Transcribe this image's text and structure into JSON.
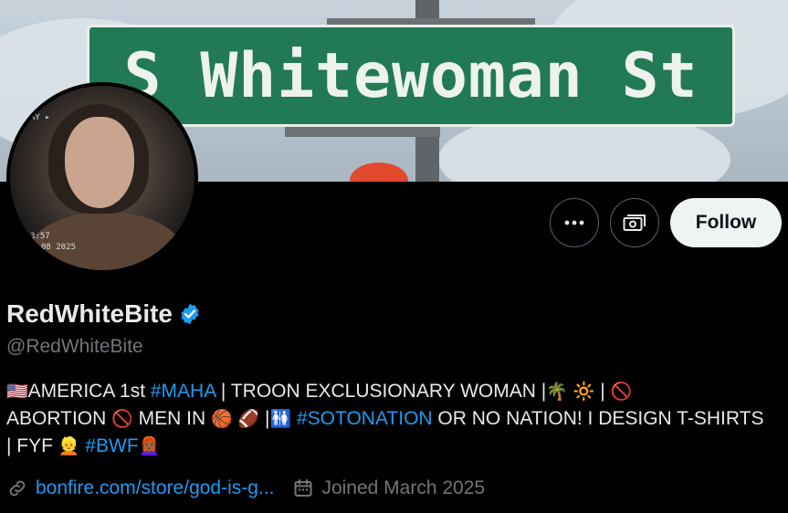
{
  "banner": {
    "sign_text": "S Whitewoman St"
  },
  "avatar": {
    "timestamp_line1": "3:57",
    "timestamp_line2": "08 2025",
    "corner_text": "AY ▸"
  },
  "actions": {
    "more_icon": "more-icon",
    "subscribe_icon": "money-icon",
    "follow_label": "Follow"
  },
  "profile": {
    "display_name": "RedWhiteBite",
    "handle": "@RedWhiteBite",
    "verified_color": "#1d9bf0",
    "bio": {
      "flag": "🇺🇸",
      "t1": "AMERICA 1st ",
      "tag_maha": "#MAHA",
      "t2": " | TROON EXCLUSIONARY WOMAN |",
      "palm": "🌴",
      "sun": "🔆",
      "t3": " | ",
      "prohibited": "🚫",
      "t4": "ABORTION ",
      "t5": " MEN IN ",
      "basketball": "🏀",
      "football": "🏈",
      "t6": " |",
      "restroom": "🚻",
      "tag_soto": "#SOTONATION",
      "t7": " OR NO NATION! I DESIGN T-SHIRTS  | FYF ",
      "blond": "👱",
      "tag_bwf": "#BWF",
      "woman": "👩🏾‍🦰"
    },
    "link_text": "bonfire.com/store/god-is-g...",
    "joined_text": "Joined March 2025"
  },
  "colors": {
    "accent": "#1d9bf0",
    "background": "#000000",
    "muted": "#71767b"
  }
}
